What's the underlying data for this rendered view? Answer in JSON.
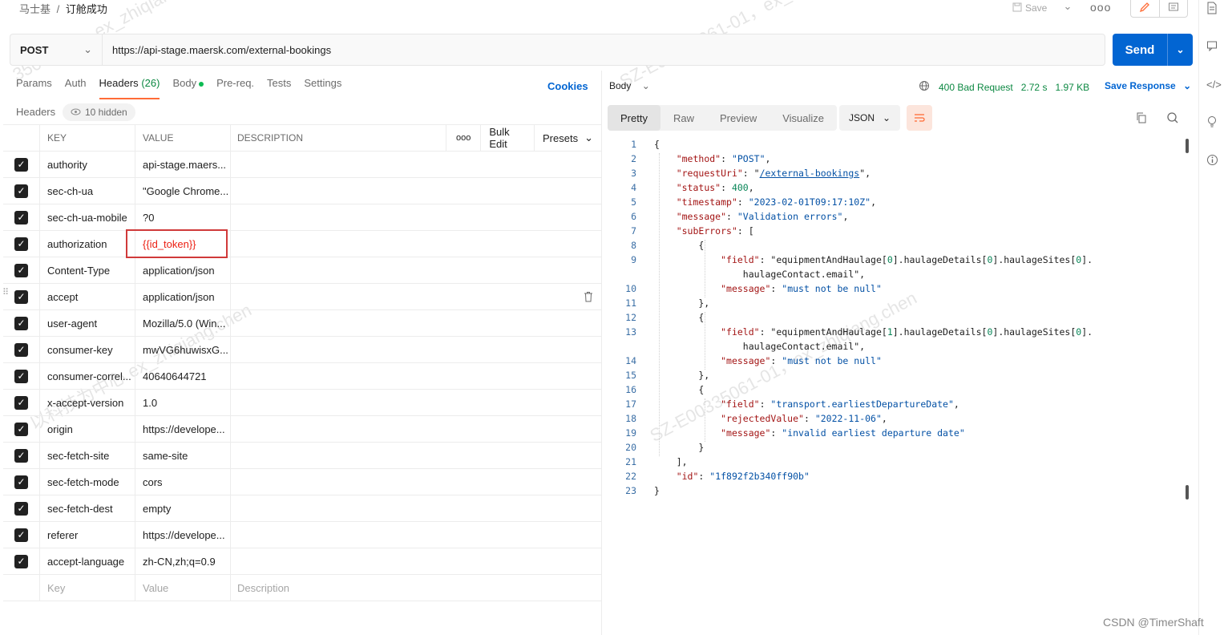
{
  "breadcrumb": {
    "parent": "马士基",
    "separator": "/",
    "current": "订舱成功"
  },
  "toolbar": {
    "save_label": "Save",
    "more_label": "ooo"
  },
  "request": {
    "method": "POST",
    "url": "https://api-stage.maersk.com/external-bookings",
    "send_label": "Send"
  },
  "tabs": [
    {
      "label": "Params"
    },
    {
      "label": "Auth"
    },
    {
      "label": "Headers",
      "count": "(26)"
    },
    {
      "label": "Body"
    },
    {
      "label": "Pre-req."
    },
    {
      "label": "Tests"
    },
    {
      "label": "Settings"
    }
  ],
  "cookies_label": "Cookies",
  "headers_section": {
    "label": "Headers",
    "hidden_label": "10 hidden"
  },
  "table": {
    "columns": {
      "key": "KEY",
      "value": "VALUE",
      "description": "DESCRIPTION"
    },
    "more_label": "ooo",
    "bulk_edit_label": "Bulk Edit",
    "presets_label": "Presets",
    "rows": [
      {
        "key": "authority",
        "value": "api-stage.maers..."
      },
      {
        "key": "sec-ch-ua",
        "value": "\"Google Chrome..."
      },
      {
        "key": "sec-ch-ua-mobile",
        "value": "?0"
      },
      {
        "key": "authorization",
        "value": "{{id_token}}"
      },
      {
        "key": "Content-Type",
        "value": "application/json"
      },
      {
        "key": "accept",
        "value": "application/json"
      },
      {
        "key": "user-agent",
        "value": "Mozilla/5.0 (Win..."
      },
      {
        "key": "consumer-key",
        "value": "mwVG6huwisxG..."
      },
      {
        "key": "consumer-correl...",
        "value": "40640644721"
      },
      {
        "key": "x-accept-version",
        "value": "1.0"
      },
      {
        "key": "origin",
        "value": "https://develope..."
      },
      {
        "key": "sec-fetch-site",
        "value": "same-site"
      },
      {
        "key": "sec-fetch-mode",
        "value": "cors"
      },
      {
        "key": "sec-fetch-dest",
        "value": "empty"
      },
      {
        "key": "referer",
        "value": "https://develope..."
      },
      {
        "key": "accept-language",
        "value": "zh-CN,zh;q=0.9"
      }
    ],
    "placeholders": {
      "key": "Key",
      "value": "Value",
      "description": "Description"
    }
  },
  "response": {
    "body_label": "Body",
    "status": "400 Bad Request",
    "time": "2.72 s",
    "size": "1.97 KB",
    "save_response_label": "Save Response",
    "view_tabs": [
      "Pretty",
      "Raw",
      "Preview",
      "Visualize"
    ],
    "format": "JSON",
    "code_lines": [
      {
        "n": "1",
        "t": "{"
      },
      {
        "n": "2",
        "t": "    \"method\": \"POST\","
      },
      {
        "n": "3",
        "t": "    \"requestUri\": \"/external-bookings\","
      },
      {
        "n": "4",
        "t": "    \"status\": 400,"
      },
      {
        "n": "5",
        "t": "    \"timestamp\": \"2023-02-01T09:17:10Z\","
      },
      {
        "n": "6",
        "t": "    \"message\": \"Validation errors\","
      },
      {
        "n": "7",
        "t": "    \"subErrors\": ["
      },
      {
        "n": "8",
        "t": "        {"
      },
      {
        "n": "9",
        "t": "            \"field\": \"equipmentAndHaulage[0].haulageDetails[0].haulageSites[0]."
      },
      {
        "n": "",
        "t": "                haulageContact.email\","
      },
      {
        "n": "10",
        "t": "            \"message\": \"must not be null\""
      },
      {
        "n": "11",
        "t": "        },"
      },
      {
        "n": "12",
        "t": "        {"
      },
      {
        "n": "13",
        "t": "            \"field\": \"equipmentAndHaulage[1].haulageDetails[0].haulageSites[0]."
      },
      {
        "n": "",
        "t": "                haulageContact.email\","
      },
      {
        "n": "14",
        "t": "            \"message\": \"must not be null\""
      },
      {
        "n": "15",
        "t": "        },"
      },
      {
        "n": "16",
        "t": "        {"
      },
      {
        "n": "17",
        "t": "            \"field\": \"transport.earliestDepartureDate\","
      },
      {
        "n": "18",
        "t": "            \"rejectedValue\": \"2022-11-06\","
      },
      {
        "n": "19",
        "t": "            \"message\": \"invalid earliest departure date\""
      },
      {
        "n": "20",
        "t": "        }"
      },
      {
        "n": "21",
        "t": "    ],"
      },
      {
        "n": "22",
        "t": "    \"id\": \"1f892f2b340ff90b\""
      },
      {
        "n": "23",
        "t": "}"
      }
    ]
  },
  "watermarks": [
    "SZ-E00335061-01，ex_",
    "以科技为中心",
    "SZ-E00335061-01，ex_zhiqiang.chen",
    "以科技为中心 ex_zhiqiang.chen",
    "35061-01，ex_zhiqiang.chen"
  ],
  "footer_watermark": "CSDN @TimerShaft",
  "colors": {
    "accent": "#ff6c37",
    "send": "#0265d2",
    "status_error": "#0c8842",
    "highlight_box": "#d03a3a"
  }
}
